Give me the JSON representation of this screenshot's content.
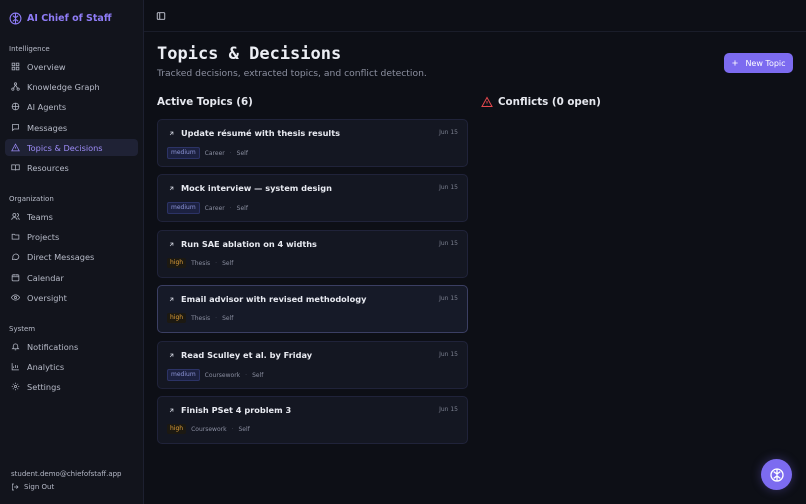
{
  "brand": {
    "name": "AI Chief of Staff"
  },
  "sidebar": {
    "sections": [
      {
        "label": "Intelligence",
        "items": [
          {
            "label": "Overview",
            "icon": "grid-icon"
          },
          {
            "label": "Knowledge Graph",
            "icon": "graph-icon"
          },
          {
            "label": "AI Agents",
            "icon": "agent-icon"
          },
          {
            "label": "Messages",
            "icon": "message-icon"
          },
          {
            "label": "Topics & Decisions",
            "icon": "triangle-icon",
            "active": true
          },
          {
            "label": "Resources",
            "icon": "book-icon"
          }
        ]
      },
      {
        "label": "Organization",
        "items": [
          {
            "label": "Teams",
            "icon": "users-icon"
          },
          {
            "label": "Projects",
            "icon": "folder-icon"
          },
          {
            "label": "Direct Messages",
            "icon": "chat-icon"
          },
          {
            "label": "Calendar",
            "icon": "calendar-icon"
          },
          {
            "label": "Oversight",
            "icon": "eye-icon"
          }
        ]
      },
      {
        "label": "System",
        "items": [
          {
            "label": "Notifications",
            "icon": "bell-icon"
          },
          {
            "label": "Analytics",
            "icon": "chart-icon"
          },
          {
            "label": "Settings",
            "icon": "gear-icon"
          }
        ]
      }
    ],
    "user_email": "student.demo@chiefofstaff.app",
    "sign_out": "Sign Out"
  },
  "page": {
    "title": "Topics & Decisions",
    "subtitle": "Tracked decisions, extracted topics, and conflict detection.",
    "new_topic_label": "New Topic"
  },
  "topics": {
    "heading": "Active Topics (6)",
    "items": [
      {
        "title": "Update résumé with thesis results",
        "date": "Jun 15",
        "priority": "medium",
        "category": "Career",
        "owner": "Self"
      },
      {
        "title": "Mock interview — system design",
        "date": "Jun 15",
        "priority": "medium",
        "category": "Career",
        "owner": "Self"
      },
      {
        "title": "Run SAE ablation on 4 widths",
        "date": "Jun 15",
        "priority": "high",
        "category": "Thesis",
        "owner": "Self"
      },
      {
        "title": "Email advisor with revised methodology",
        "date": "Jun 15",
        "priority": "high",
        "category": "Thesis",
        "owner": "Self"
      },
      {
        "title": "Read Sculley et al. by Friday",
        "date": "Jun 15",
        "priority": "medium",
        "category": "Coursework",
        "owner": "Self"
      },
      {
        "title": "Finish PSet 4 problem 3",
        "date": "Jun 15",
        "priority": "high",
        "category": "Coursework",
        "owner": "Self"
      }
    ]
  },
  "conflicts": {
    "heading": "Conflicts (0 open)"
  },
  "colors": {
    "accent": "#7c6bf0",
    "high": "#e0a03a",
    "medium": "#8d95d8",
    "warning": "#e5484d"
  }
}
